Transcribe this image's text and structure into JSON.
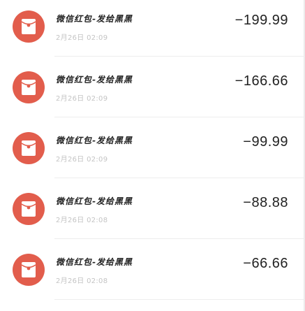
{
  "transactions": [
    {
      "title": "微信红包-发给黑黑",
      "time": "2月26日 02:09",
      "amount": "−199.99",
      "icon": "red-envelope-icon"
    },
    {
      "title": "微信红包-发给黑黑",
      "time": "2月26日 02:09",
      "amount": "−166.66",
      "icon": "red-envelope-icon"
    },
    {
      "title": "微信红包-发给黑黑",
      "time": "2月26日 02:09",
      "amount": "−99.99",
      "icon": "red-envelope-icon"
    },
    {
      "title": "微信红包-发给黑黑",
      "time": "2月26日 02:08",
      "amount": "−88.88",
      "icon": "red-envelope-icon"
    },
    {
      "title": "微信红包-发给黑黑",
      "time": "2月26日 02:08",
      "amount": "−66.66",
      "icon": "red-envelope-icon"
    }
  ],
  "colors": {
    "icon_background": "#e25d4c",
    "title": "#222222",
    "time": "#c4c4c4",
    "amount": "#222222"
  }
}
